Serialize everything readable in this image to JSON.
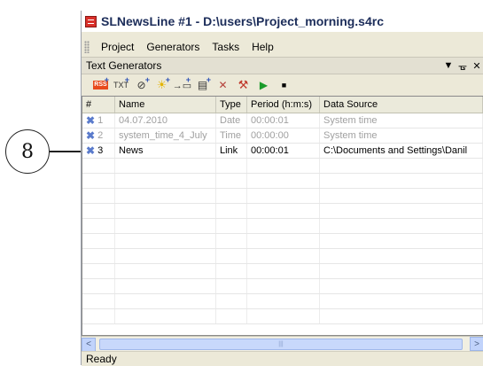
{
  "callout": {
    "number": "8"
  },
  "window": {
    "title": "SLNewsLine #1  - D:\\users\\Project_morning.s4rc"
  },
  "menu": {
    "items": [
      "Project",
      "Generators",
      "Tasks",
      "Help"
    ]
  },
  "panel": {
    "title": "Text Generators",
    "dropdown_glyph": "▼",
    "pin_glyph": "ᚗ",
    "close_glyph": "✕"
  },
  "toolbar": {
    "icons": [
      "rss-add-icon",
      "txt-add-icon",
      "clock-add-icon",
      "bulb-add-icon",
      "link-add-icon",
      "doc-add-icon",
      "delete-icon",
      "tools-icon",
      "play-icon",
      "stop-icon"
    ]
  },
  "table": {
    "columns": [
      "#",
      "Name",
      "Type",
      "Period (h:m:s)",
      "Data Source"
    ],
    "rows": [
      {
        "num": "1",
        "name": "04.07.2010",
        "type": "Date",
        "period": "00:00:01",
        "source": "System time",
        "state": "disabled"
      },
      {
        "num": "2",
        "name": "system_time_4_July",
        "type": "Time",
        "period": "00:00:00",
        "source": "System time",
        "state": "disabled"
      },
      {
        "num": "3",
        "name": "News",
        "type": "Link",
        "period": "00:00:01",
        "source": "C:\\Documents and Settings\\Danil",
        "state": "active"
      }
    ],
    "empty_row_count": 11
  },
  "status": {
    "text": "Ready"
  },
  "colors": {
    "title": "#1c2d5a",
    "disabled_text": "#a0a0a0",
    "accent": "#5a7bcc"
  }
}
